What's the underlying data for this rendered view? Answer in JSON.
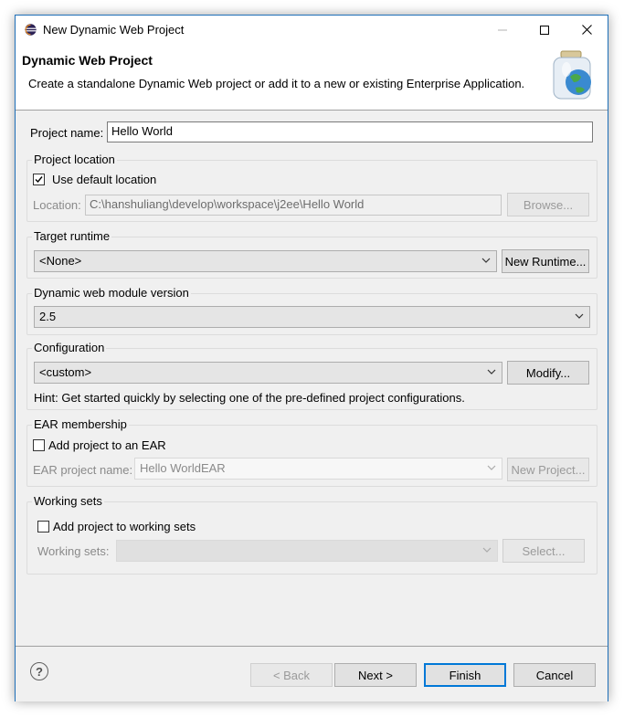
{
  "window": {
    "title": "New Dynamic Web Project"
  },
  "header": {
    "title": "Dynamic Web Project",
    "description": "Create a standalone Dynamic Web project or add it to a new or existing Enterprise Application."
  },
  "project_name": {
    "label": "Project name:",
    "value": "Hello World"
  },
  "project_location": {
    "group_label": "Project location",
    "use_default_label": "Use default location",
    "use_default_checked": true,
    "location_label": "Location:",
    "location_value": "C:\\hanshuliang\\develop\\workspace\\j2ee\\Hello World",
    "browse_label": "Browse..."
  },
  "target_runtime": {
    "group_label": "Target runtime",
    "selected": "<None>",
    "new_runtime_label": "New Runtime..."
  },
  "module_version": {
    "group_label": "Dynamic web module version",
    "selected": "2.5"
  },
  "configuration": {
    "group_label": "Configuration",
    "selected": "<custom>",
    "modify_label": "Modify...",
    "hint": "Hint: Get started quickly by selecting one of the pre-defined project configurations."
  },
  "ear": {
    "group_label": "EAR membership",
    "add_label": "Add project to an EAR",
    "add_checked": false,
    "name_label": "EAR project name:",
    "name_value": "Hello WorldEAR",
    "new_project_label": "New Project..."
  },
  "working_sets": {
    "group_label": "Working sets",
    "add_label": "Add project to working sets",
    "add_checked": false,
    "sets_label": "Working sets:",
    "sets_value": "",
    "select_label": "Select..."
  },
  "footer": {
    "back_label": "< Back",
    "next_label": "Next >",
    "finish_label": "Finish",
    "cancel_label": "Cancel"
  },
  "colors": {
    "accent": "#0078d7",
    "window_border": "#1e6fb8",
    "dialog_bg": "#f0f0f0"
  }
}
